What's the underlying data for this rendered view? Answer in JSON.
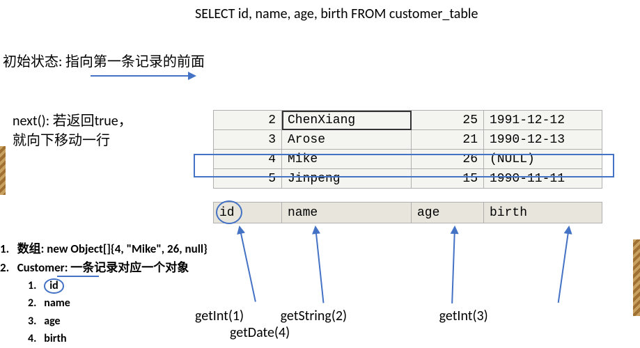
{
  "sql": "SELECT id, name, age, birth FROM customer_table",
  "initial_state": "初始状态: 指向第一条记录的前面",
  "next_desc_line1": "next(): 若返回true，",
  "next_desc_line2": "就向下移动一行",
  "table_rows": [
    {
      "id": "2",
      "name": "ChenXiang",
      "age": "25",
      "birth": "1991-12-12"
    },
    {
      "id": "3",
      "name": "Arose",
      "age": "21",
      "birth": "1990-12-13"
    },
    {
      "id": "4",
      "name": "Mike",
      "age": "26",
      "birth": "(NULL)"
    },
    {
      "id": "5",
      "name": "Jinpeng",
      "age": "15",
      "birth": "1990-11-11"
    }
  ],
  "headers": {
    "id": "id",
    "name": "name",
    "age": "age",
    "birth": "birth"
  },
  "list": {
    "item1": "数组: new Object[]{4, \"Mike\", 26, null}",
    "item2": "Customer: 一条记录对应一个对象",
    "sub1": "id",
    "sub2": "name",
    "sub3": "age",
    "sub4": "birth"
  },
  "methods": {
    "m1": "getInt(1)",
    "m2": "getString(2)",
    "m3": "getInt(3)",
    "m4": "getDate(4)"
  }
}
